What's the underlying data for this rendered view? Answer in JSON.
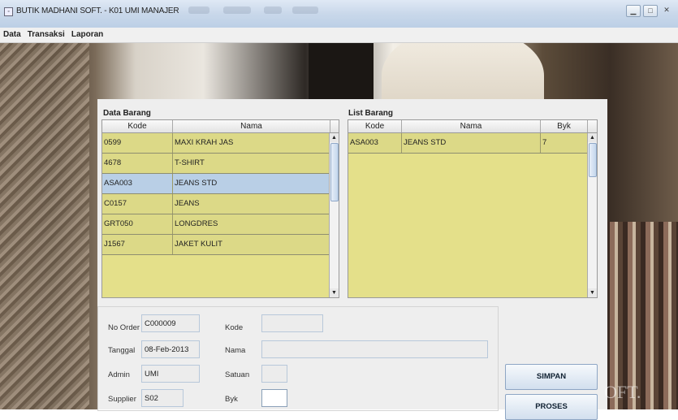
{
  "window": {
    "title": "BUTIK MADHANI SOFT. - K01 UMI MANAJER"
  },
  "menubar": {
    "items": [
      "Data",
      "Transaksi",
      "Laporan"
    ]
  },
  "data_barang": {
    "title": "Data Barang",
    "columns": [
      "Kode",
      "Nama"
    ],
    "rows": [
      [
        "0599",
        "MAXI KRAH JAS"
      ],
      [
        "4678",
        "T-SHIRT"
      ],
      [
        "ASA003",
        "JEANS STD"
      ],
      [
        "C0157",
        "JEANS"
      ],
      [
        "GRT050",
        "LONGDRES"
      ],
      [
        "J1567",
        "JAKET KULIT"
      ]
    ]
  },
  "list_barang": {
    "title": "List Barang",
    "columns": [
      "Kode",
      "Nama",
      "Byk"
    ],
    "rows": [
      [
        "ASA003",
        "JEANS STD",
        "7"
      ]
    ]
  },
  "form": {
    "no_order_label": "No Order",
    "no_order_value": "C000009",
    "tanggal_label": "Tanggal",
    "tanggal_value": "08-Feb-2013",
    "admin_label": "Admin",
    "admin_value": "UMI",
    "supplier_label": "Supplier",
    "supplier_value": "S02",
    "kode_label": "Kode",
    "kode_value": "",
    "nama_label": "Nama",
    "nama_value": "",
    "satuan_label": "Satuan",
    "satuan_value": "",
    "byk_label": "Byk",
    "byk_value": ""
  },
  "buttons": {
    "simpan": "SIMPAN",
    "proses": "PROSES"
  },
  "watermark": "OFT."
}
